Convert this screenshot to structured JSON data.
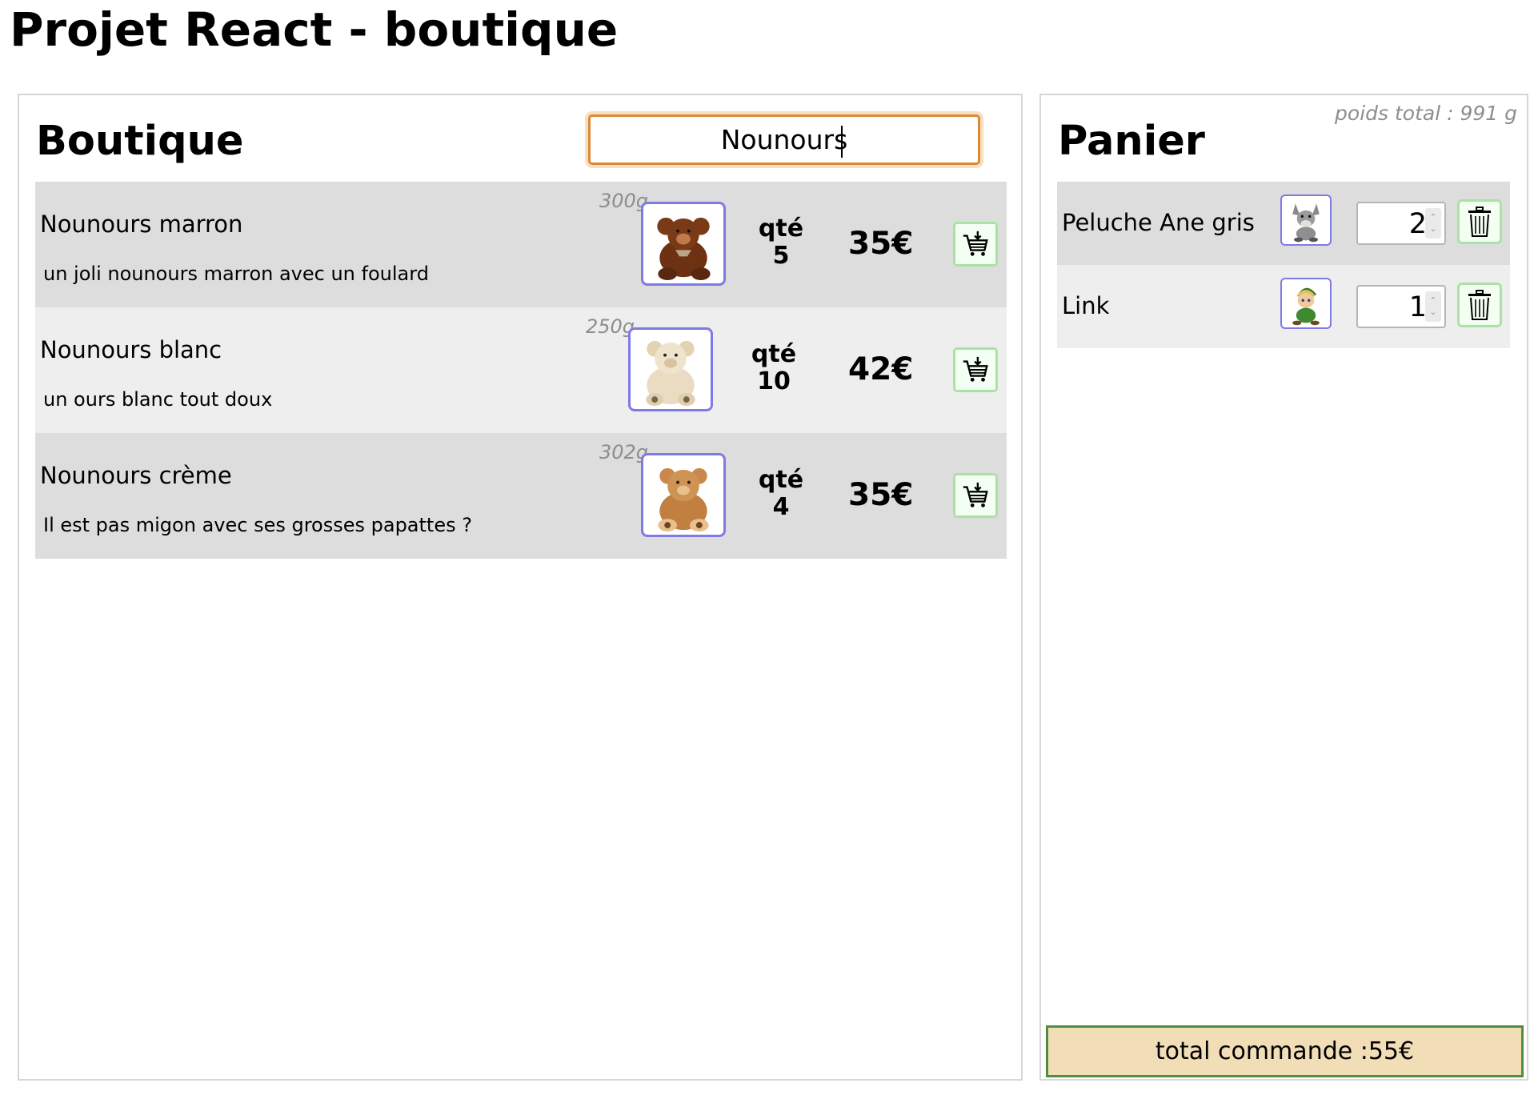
{
  "page": {
    "title": "Projet React - boutique"
  },
  "shop": {
    "heading": "Boutique",
    "search": {
      "value": "Nounours",
      "placeholder": ""
    },
    "products": [
      {
        "name": "Nounours marron",
        "description": "un joli nounours marron avec un foulard",
        "weight": "300g",
        "qty_label": "qté",
        "qty": "5",
        "price": "35€",
        "image": "brown-teddy-bear",
        "color": "#7a3a17"
      },
      {
        "name": "Nounours blanc",
        "description": "un ours blanc tout doux",
        "weight": "250g",
        "qty_label": "qté",
        "qty": "10",
        "price": "42€",
        "image": "white-teddy-bear",
        "color": "#e8d9bd"
      },
      {
        "name": "Nounours crème",
        "description": "Il est pas migon avec ses grosses papattes ?",
        "weight": "302g",
        "qty_label": "qté",
        "qty": "4",
        "price": "35€",
        "image": "cream-teddy-bear",
        "color": "#c9894a"
      }
    ],
    "add_to_cart_icon": "cart-add-icon"
  },
  "cart": {
    "heading": "Panier",
    "total_weight": "poids total : 991 g",
    "items": [
      {
        "name": "Peluche Ane gris",
        "qty": "2",
        "image": "grey-donkey-plush"
      },
      {
        "name": "Link",
        "qty": "1",
        "image": "link-plush"
      }
    ],
    "delete_icon": "trash-icon",
    "total": "total commande :55€"
  },
  "colors": {
    "accent_border": "#7e7ae6",
    "button_border": "#a9e3a4",
    "search_border": "#d98a38",
    "total_bg": "#f2deb6",
    "total_border": "#4d8f3a"
  }
}
